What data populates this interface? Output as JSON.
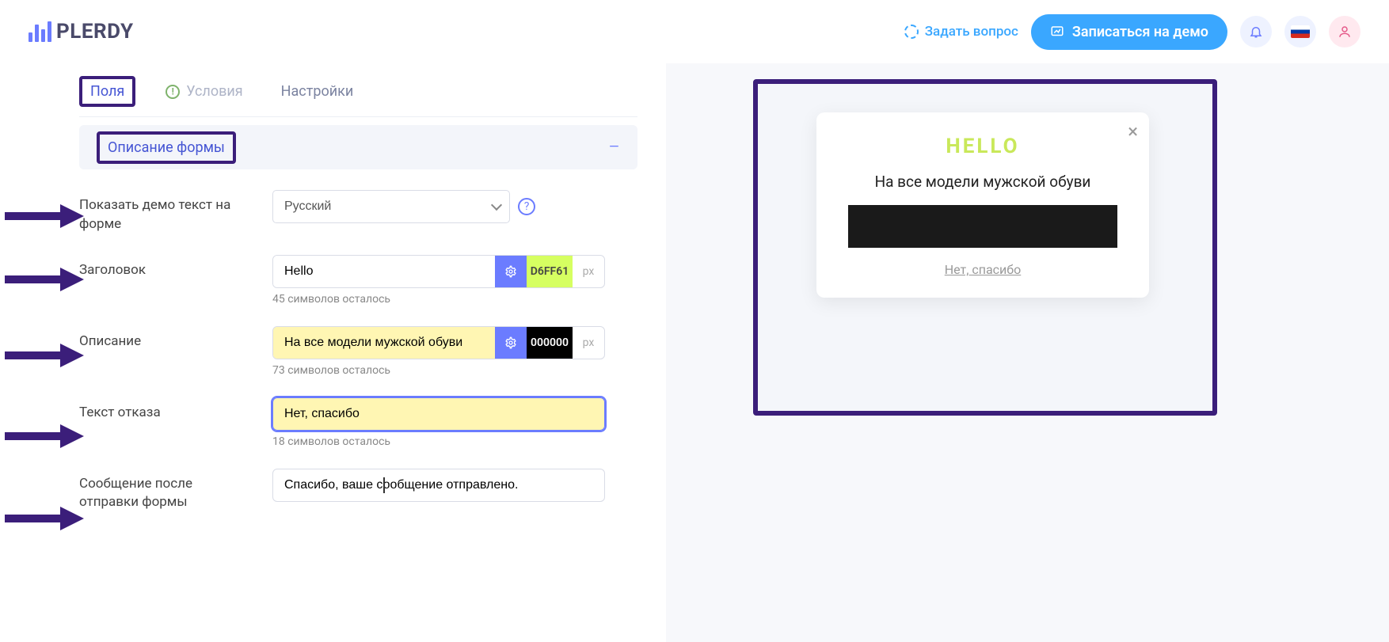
{
  "header": {
    "logo_text": "PLERDY",
    "ask_label": "Задать вопрос",
    "demo_label": "Записаться на демо"
  },
  "tabs": {
    "fields": "Поля",
    "conditions": "Условия",
    "settings": "Настройки"
  },
  "accordion": {
    "title": "Описание формы"
  },
  "form": {
    "demo_text_label": "Показать демо текст на форме",
    "language_value": "Русский",
    "title_label": "Заголовок",
    "title_value": "Hello",
    "title_color": "D6FF61",
    "title_helper": "45 символов осталось",
    "desc_label": "Описание",
    "desc_value": "На все модели мужской обуви",
    "desc_color": "000000",
    "desc_helper": "73 символов осталось",
    "refuse_label": "Текст отказа",
    "refuse_value": "Нет, спасибо",
    "refuse_helper": "18 символов осталось",
    "after_label": "Сообщение после отправки формы",
    "after_value": "Спасибо, ваше сообщение отправлено.",
    "px": "px"
  },
  "preview": {
    "hello": "HELLO",
    "desc": "На все модели мужской обуви",
    "refuse": "Нет, спасибо"
  }
}
